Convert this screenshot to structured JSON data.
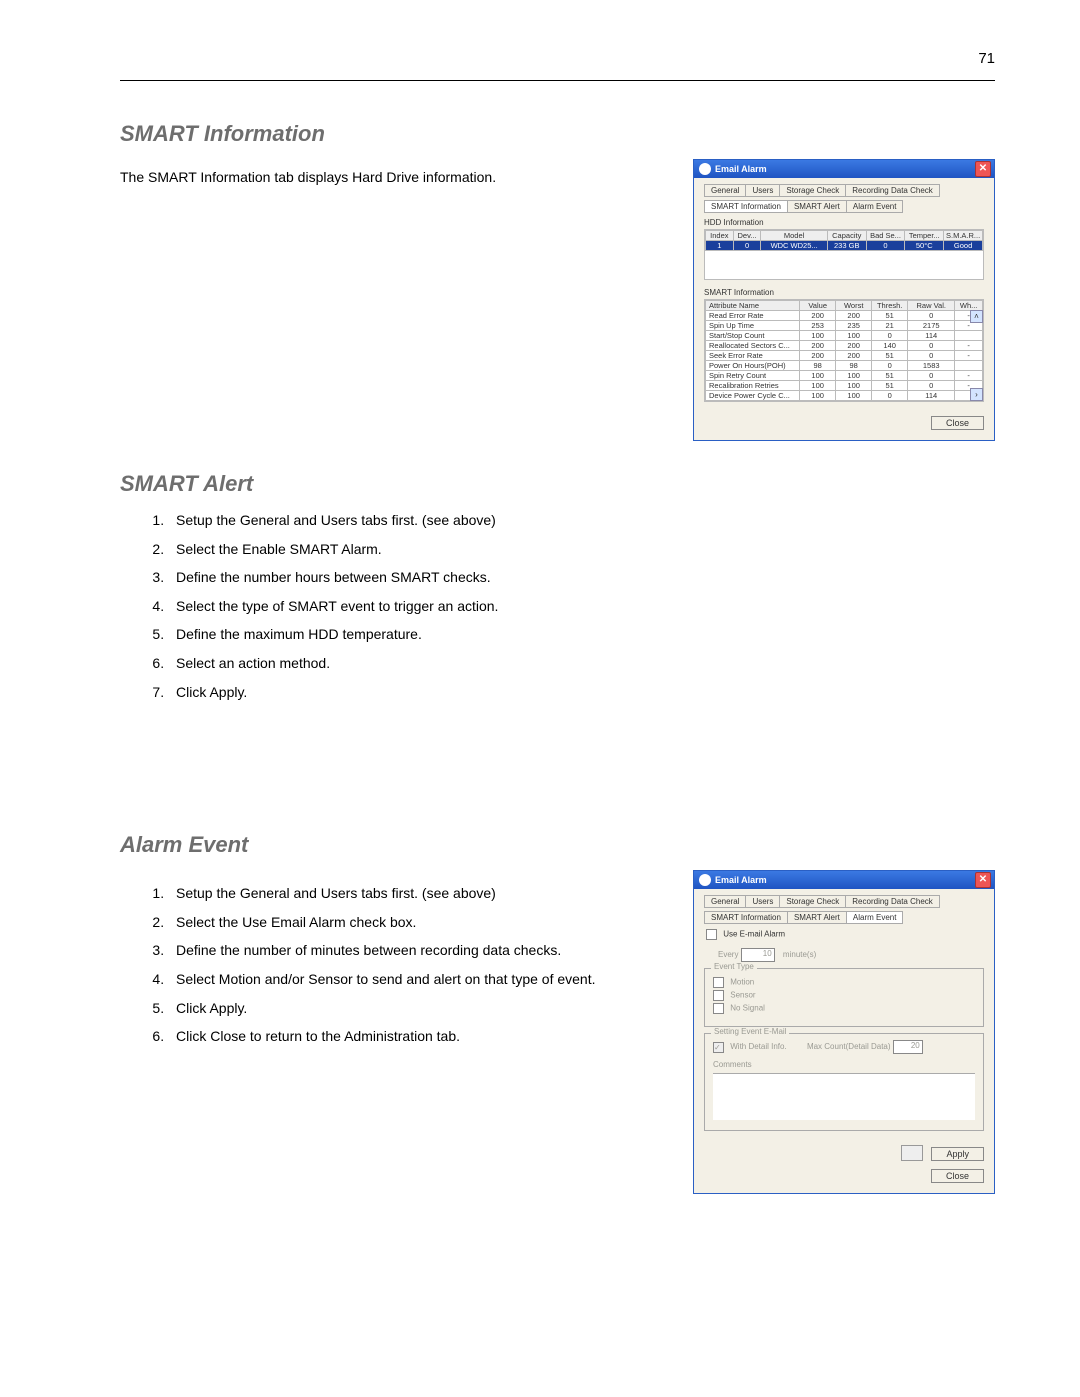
{
  "page_number": "71",
  "sect1": {
    "heading": "SMART Information",
    "lead": "The SMART Information tab displays Hard Drive information."
  },
  "sect2": {
    "heading": "SMART Alert",
    "steps": [
      "Setup the General and Users tabs first. (see above)",
      "Select the Enable SMART Alarm.",
      "Define the number hours between SMART checks.",
      "Select the type of SMART event to trigger an action.",
      "Define the maximum HDD temperature.",
      "Select an action method.",
      "Click Apply."
    ]
  },
  "sect3": {
    "heading": "Alarm Event",
    "steps": [
      "Setup the General and Users tabs first. (see above)",
      "Select the Use Email Alarm check box.",
      "Define the number of minutes between recording data checks.",
      "Select Motion and/or Sensor to send and alert on that type of event.",
      "Click Apply.",
      "Click Close to return to the Administration tab."
    ]
  },
  "dlg1": {
    "title": "Email Alarm",
    "tabs_top": [
      "General",
      "Users",
      "Storage Check",
      "Recording Data Check"
    ],
    "tabs_bottom": [
      "SMART Information",
      "SMART Alert",
      "Alarm Event"
    ],
    "hdd_label": "HDD Information",
    "hdd_cols": [
      "Index",
      "Dev...",
      "Model",
      "Capacity",
      "Bad Se...",
      "Temper...",
      "S.M.A.R..."
    ],
    "hdd_row": [
      "1",
      "0",
      "WDC WD25...",
      "233 GB",
      "0",
      "50°C",
      "Good"
    ],
    "smart_label": "SMART Information",
    "smart_cols": [
      "Attribute Name",
      "Value",
      "Worst",
      "Thresh.",
      "Raw Val.",
      "Wh..."
    ],
    "smart_rows": [
      [
        "Read Error Rate",
        "200",
        "200",
        "51",
        "0",
        "-"
      ],
      [
        "Spin Up Time",
        "253",
        "235",
        "21",
        "2175",
        "-"
      ],
      [
        "Start/Stop Count",
        "100",
        "100",
        "0",
        "114",
        ""
      ],
      [
        "Reallocated Sectors C...",
        "200",
        "200",
        "140",
        "0",
        "-"
      ],
      [
        "Seek Error Rate",
        "200",
        "200",
        "51",
        "0",
        "-"
      ],
      [
        "Power On Hours(POH)",
        "98",
        "98",
        "0",
        "1583",
        ""
      ],
      [
        "Spin Retry Count",
        "100",
        "100",
        "51",
        "0",
        "-"
      ],
      [
        "Recalibration Retries",
        "100",
        "100",
        "51",
        "0",
        "-"
      ],
      [
        "Device Power Cycle C...",
        "100",
        "100",
        "0",
        "114",
        ""
      ]
    ],
    "close": "Close"
  },
  "dlg2": {
    "title": "Email Alarm",
    "tabs_top": [
      "General",
      "Users",
      "Storage Check",
      "Recording Data Check"
    ],
    "tabs_bottom": [
      "SMART Information",
      "SMART Alert",
      "Alarm Event"
    ],
    "use_label": "Use E-mail Alarm",
    "every": "Every",
    "every_val": "10",
    "every_unit": "minute(s)",
    "event_type": "Event Type",
    "events": [
      "Motion",
      "Sensor",
      "No Signal"
    ],
    "setting_label": "Setting Event E-Mail",
    "detail": "With Detail Info.",
    "maxcount": "Max Count(Detail Data)",
    "maxcount_val": "20",
    "comments": "Comments",
    "apply": "Apply",
    "close": "Close"
  }
}
